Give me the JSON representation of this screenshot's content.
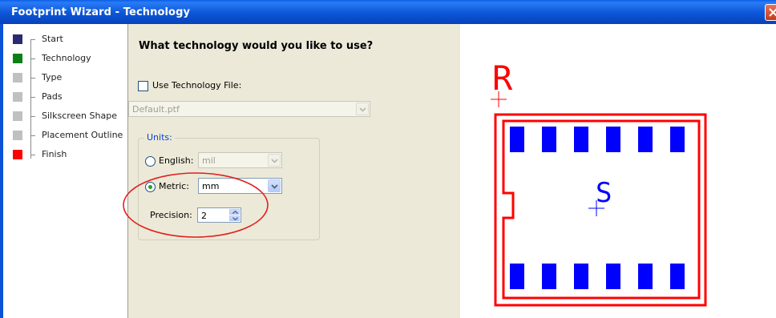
{
  "window": {
    "title": "Footprint Wizard - Technology"
  },
  "steps": [
    {
      "label": "Start",
      "color": "#2b2a70"
    },
    {
      "label": "Technology",
      "color": "#0a7f16"
    },
    {
      "label": "Type",
      "color": "#c0c0c0"
    },
    {
      "label": "Pads",
      "color": "#c0c0c0"
    },
    {
      "label": "Silkscreen Shape",
      "color": "#c0c0c0"
    },
    {
      "label": "Placement Outline",
      "color": "#c0c0c0"
    },
    {
      "label": "Finish",
      "color": "#ff0000"
    }
  ],
  "options": {
    "heading": "What technology would you like to use?",
    "use_tech_file": {
      "label": "Use Technology File:",
      "checked": false
    },
    "tech_file": {
      "value": "Default.ptf"
    },
    "units_label": "Units:",
    "english": {
      "label": "English:",
      "value": "mil",
      "selected": false
    },
    "metric": {
      "label": "Metric:",
      "value": "mm",
      "selected": true
    },
    "precision": {
      "label": "Precision:",
      "value": "2"
    }
  },
  "preview": {
    "ref_label": "R",
    "value_label": "S",
    "outline_color": "#ff0000",
    "pad_color": "#0000ff",
    "pads_per_row": 6
  }
}
